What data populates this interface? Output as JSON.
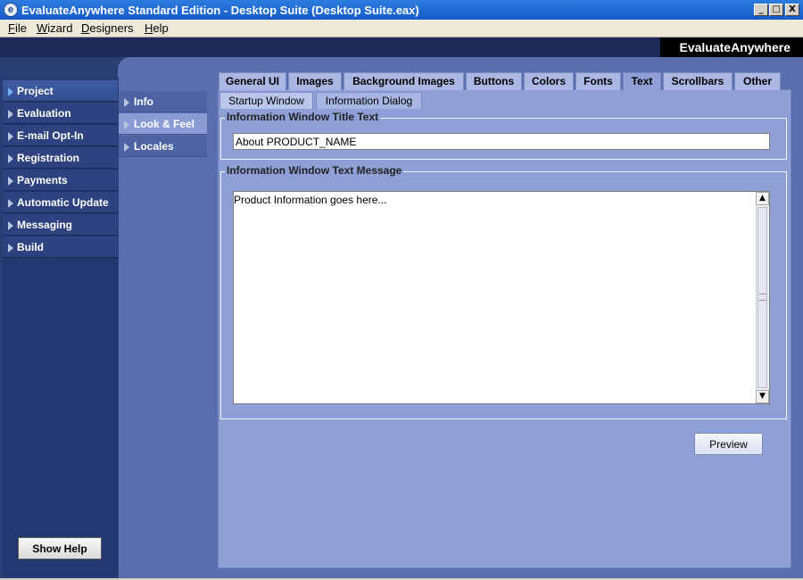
{
  "window": {
    "title": "EvaluateAnywhere Standard Edition - Desktop Suite (Desktop Suite.eax)",
    "icon": "e",
    "controls": [
      "_",
      "□",
      "X"
    ]
  },
  "menu": [
    {
      "key": "F",
      "rest": "ile"
    },
    {
      "key": "W",
      "rest": "izard"
    },
    {
      "key": "D",
      "rest": "esigners"
    },
    {
      "key": "H",
      "rest": "elp"
    }
  ],
  "brand": "EvaluateAnywhere",
  "left_nav": {
    "items": [
      "Project",
      "Evaluation",
      "E-mail Opt-In",
      "Registration",
      "Payments",
      "Automatic Update",
      "Messaging",
      "Build"
    ],
    "active_index": 0
  },
  "sub_nav": {
    "items": [
      "Info",
      "Look & Feel",
      "Locales"
    ],
    "active_index": 1
  },
  "tabs": {
    "items": [
      "General UI",
      "Images",
      "Background Images",
      "Buttons",
      "Colors",
      "Fonts",
      "Text",
      "Scrollbars",
      "Other"
    ],
    "active": "Text"
  },
  "subtabs": {
    "items": [
      "Startup Window",
      "Information Dialog"
    ],
    "active": "Information Dialog"
  },
  "title_group": {
    "label": "Information Window Title Text",
    "value": "About PRODUCT_NAME"
  },
  "message_group": {
    "label": "Information Window Text Message",
    "value": "Product Information goes here..."
  },
  "buttons": {
    "preview": "Preview",
    "show_help": "Show Help"
  },
  "colors": {
    "titlebar": "#1659c9",
    "dark_blue": "#2b3e74",
    "panel_blue": "#8ea0d6",
    "brand_bg": "#000000"
  }
}
